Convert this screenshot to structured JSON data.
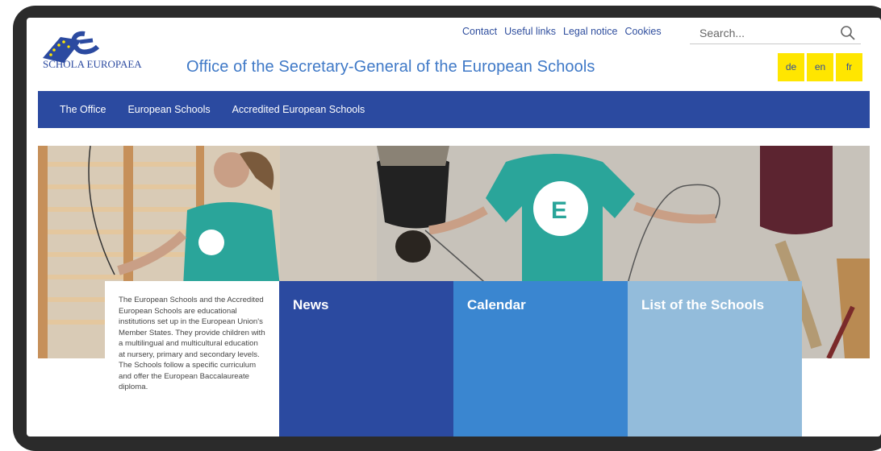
{
  "header": {
    "logo_text": "SCHOLA EUROPAEA",
    "site_title": "Office of the Secretary-General of the European Schools"
  },
  "toplinks": [
    "Contact",
    "Useful links",
    "Legal notice",
    "Cookies"
  ],
  "search": {
    "placeholder": "Search..."
  },
  "languages": [
    "de",
    "en",
    "fr"
  ],
  "nav": [
    "The Office",
    "European Schools",
    "Accredited European Schools"
  ],
  "intro": {
    "paragraph1": "The European Schools and the Accredited European Schools are educational institutions set up in the European Union's Member States. They provide children with a multilingual and multicultural education at nursery, primary and secondary levels.",
    "paragraph2": "The Schools follow a specific curriculum and offer the European Baccalaureate diploma."
  },
  "tiles": {
    "news": "News",
    "calendar": "Calendar",
    "schools": "List of the Schools"
  },
  "colors": {
    "nav": "#2b4aa0",
    "tile_news": "#2b4aa0",
    "tile_calendar": "#3a86d0",
    "tile_schools": "#93bcdb",
    "lang": "#ffe600",
    "title": "#3f79c7"
  }
}
